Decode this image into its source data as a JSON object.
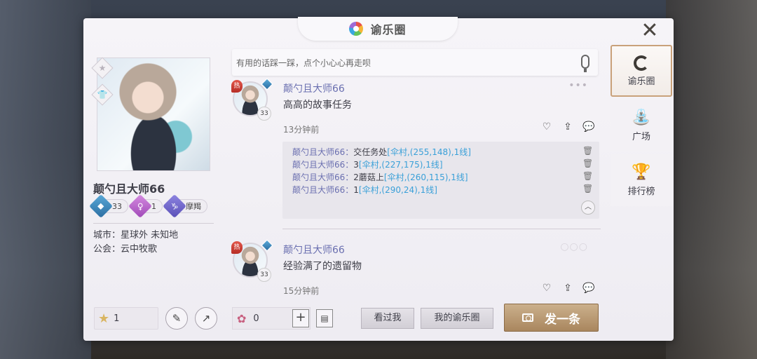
{
  "header": {
    "title": "谕乐圈",
    "close": "✕"
  },
  "search": {
    "placeholder": "有用的话踩一踩，点个小心心再走呗"
  },
  "profile": {
    "name": "颠勺且大师66",
    "badges": [
      {
        "value": "33",
        "icon": "diamond-icon"
      },
      {
        "value": "1",
        "icon": "female-icon"
      },
      {
        "value": "摩羯",
        "icon": "capricorn-icon"
      }
    ],
    "city": "城市：星球外 未知地",
    "guild": "公会：云中牧歌",
    "stars": "1"
  },
  "posts": [
    {
      "name": "颠勺且大师66",
      "text": "高高的故事任务",
      "time": "13分钟前",
      "level": "33",
      "hot": "热",
      "comments": [
        {
          "name": "颠勺且大师66：",
          "text": "交任务处",
          "loc": "[伞村,(255,148),1线]"
        },
        {
          "name": "颠勺且大师66：",
          "text": "3",
          "loc": "[伞村,(227,175),1线]"
        },
        {
          "name": "颠勺且大师66：",
          "text": "2蘑菇上",
          "loc": "[伞村,(260,115),1线]"
        },
        {
          "name": "颠勺且大师66：",
          "text": "1",
          "loc": "[伞村,(290,24),1线]"
        }
      ]
    },
    {
      "name": "颠勺且大师66",
      "text": "经验满了的遗留物",
      "time": "15分钟前",
      "level": "33",
      "hot": "热"
    }
  ],
  "bottom": {
    "flowers": "0",
    "btn_seen": "看过我",
    "btn_mine": "我的谕乐圈",
    "btn_post": "发一条"
  },
  "tabs": [
    {
      "label": "谕乐圈",
      "icon": "roll-icon"
    },
    {
      "label": "广场",
      "icon": "fountain-icon"
    },
    {
      "label": "排行榜",
      "icon": "trophy-icon"
    }
  ]
}
